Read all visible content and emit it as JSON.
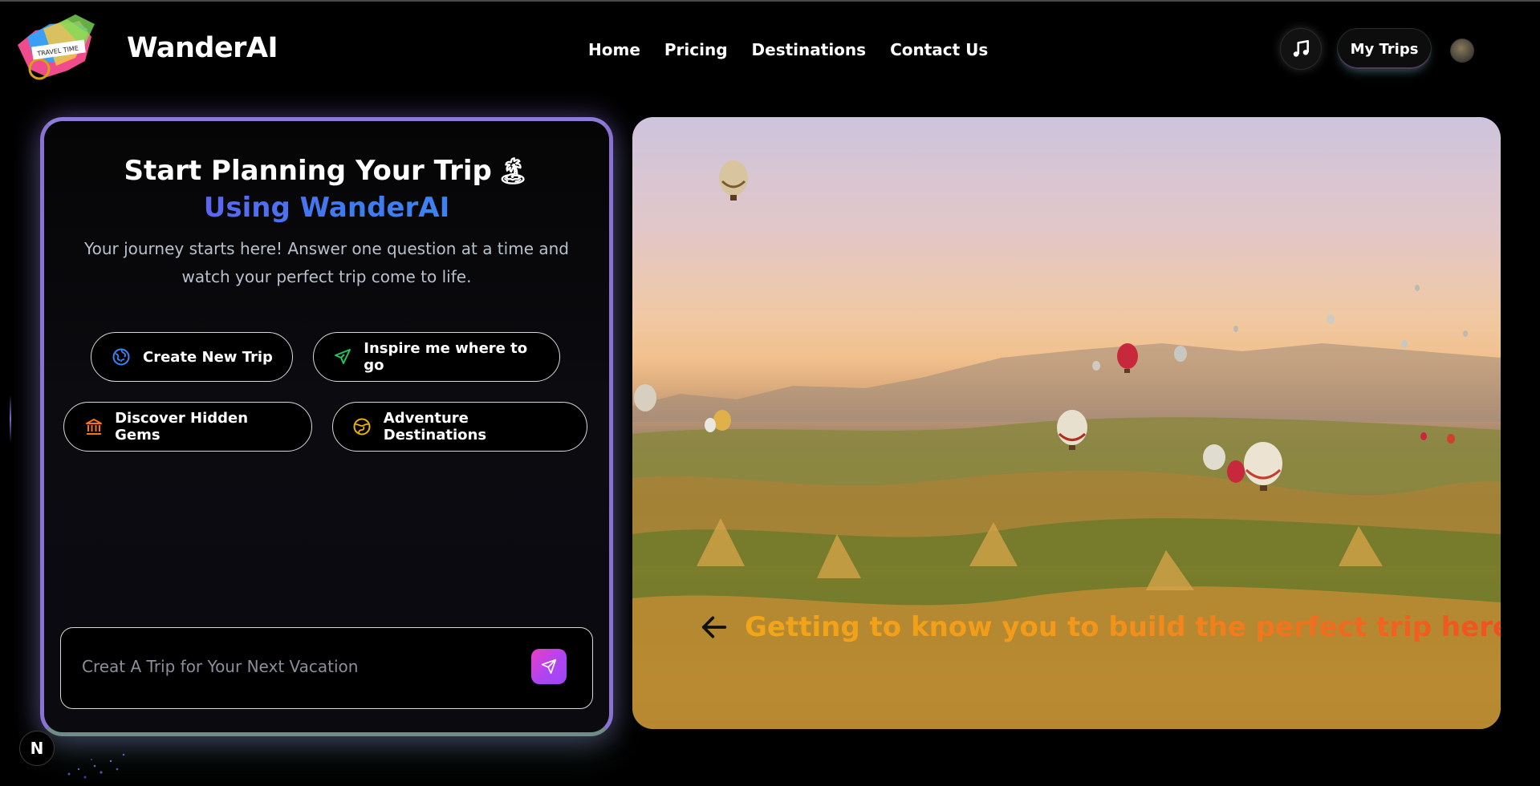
{
  "navbar": {
    "brand": "WanderAI",
    "logo_text": "TRAVEL TIME",
    "links": [
      "Home",
      "Pricing",
      "Destinations",
      "Contact Us"
    ],
    "music_icon": "music-note-icon",
    "my_trips_label": "My Trips"
  },
  "planner": {
    "title": "Start Planning Your Trip",
    "title_emoji": "🏝",
    "subtitle": "Using WanderAI",
    "description": "Your journey starts here! Answer one question at a time and watch your perfect trip come to life.",
    "options": [
      {
        "label": "Create New Trip",
        "icon": "globe-icon"
      },
      {
        "label": "Inspire me where to go",
        "icon": "plane-icon"
      },
      {
        "label": "Discover Hidden Gems",
        "icon": "landmark-icon"
      },
      {
        "label": "Adventure Destinations",
        "icon": "compass-globe-icon"
      }
    ],
    "input_placeholder": "Creat A Trip for Your Next Vacation",
    "send_icon": "send-icon"
  },
  "hero": {
    "caption": "Getting to know you to build the perfect trip here...",
    "back_icon": "arrow-left-icon"
  },
  "framework_badge": "N",
  "colors": {
    "accent_purple": "#8e7ad8",
    "subtitle_start": "#7a4ff0",
    "subtitle_end": "#3f90f5",
    "caption_start": "#f1a619",
    "caption_end": "#ef4a22",
    "send_gradient_start": "#e83ec7",
    "send_gradient_end": "#9a46f5"
  }
}
